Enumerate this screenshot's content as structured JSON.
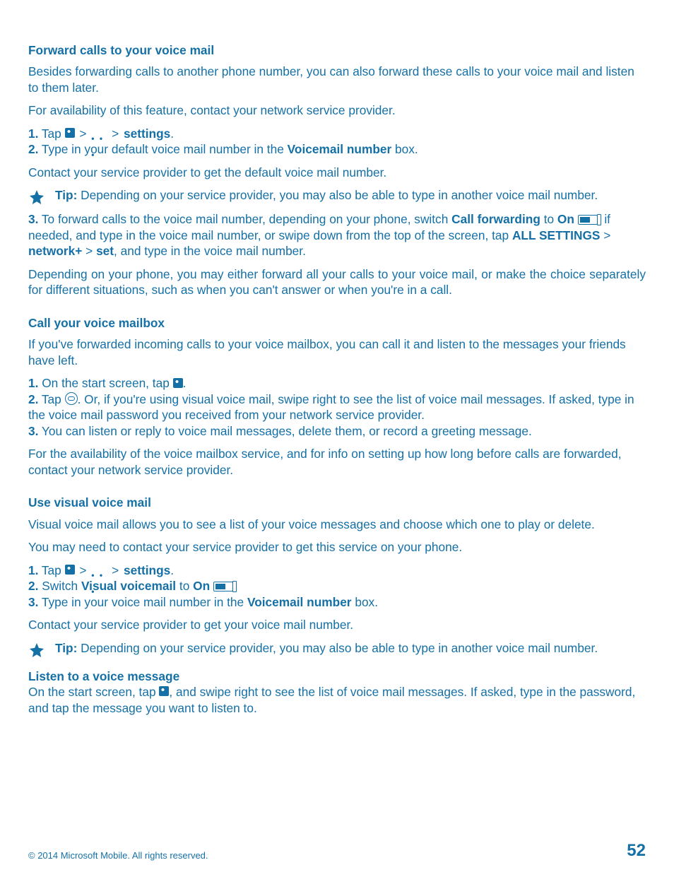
{
  "s1": {
    "heading": "Forward calls to your voice mail",
    "p1": "Besides forwarding calls to another phone number, you can also forward these calls to your voice mail and listen to them later.",
    "p2": "For availability of this feature, contact your network service provider.",
    "step1_a": "1.",
    "step1_b": " Tap ",
    "step1_c": " > ",
    "step1_d": " > ",
    "step1_e": "settings",
    "step1_f": ".",
    "step2_a": "2.",
    "step2_b": " Type in your default voice mail number in the ",
    "step2_c": "Voicemail number",
    "step2_d": " box.",
    "p3": "Contact your service provider to get the default voice mail number.",
    "tip_a": "Tip:",
    "tip_b": " Depending on your service provider, you may also be able to type in another voice mail number.",
    "step3_a": "3.",
    "step3_b": " To forward calls to the voice mail number, depending on your phone, switch ",
    "step3_c": "Call forwarding",
    "step3_d": " to ",
    "step3_e": "On",
    "step3_f": ", if needed, and type in the voice mail number, or swipe down from the top of the screen, tap ",
    "step3_g": "ALL SETTINGS",
    "step3_h": " > ",
    "step3_i": "network+",
    "step3_j": " > ",
    "step3_k": "set",
    "step3_l": ", and type in the voice mail number.",
    "p4": "Depending on your phone, you may either forward all your calls to your voice mail, or make the choice separately for different situations, such as when you can't answer or when you're in a call."
  },
  "s2": {
    "heading": "Call your voice mailbox",
    "p1": "If you've forwarded incoming calls to your voice mailbox, you can call it and listen to the messages your friends have left.",
    "step1_a": "1.",
    "step1_b": " On the start screen, tap ",
    "step1_c": ".",
    "step2_a": "2.",
    "step2_b": " Tap ",
    "step2_c": ". Or, if you're using visual voice mail, swipe right to see the list of voice mail messages. If asked, type in the voice mail password you received from your network service provider.",
    "step3_a": "3.",
    "step3_b": " You can listen or reply to voice mail messages, delete them, or record a greeting message.",
    "p2": "For the availability of the voice mailbox service, and for info on setting up how long before calls are forwarded, contact your network service provider."
  },
  "s3": {
    "heading": "Use visual voice mail",
    "p1": "Visual voice mail allows you to see a list of your voice messages and choose which one to play or delete.",
    "p2": "You may need to contact your service provider to get this service on your phone.",
    "step1_a": "1.",
    "step1_b": " Tap ",
    "step1_c": " > ",
    "step1_d": " > ",
    "step1_e": "settings",
    "step1_f": ".",
    "step2_a": "2.",
    "step2_b": " Switch ",
    "step2_c": "Visual voicemail",
    "step2_d": " to ",
    "step2_e": "On",
    "step2_f": ".",
    "step3_a": "3.",
    "step3_b": " Type in your voice mail number in the ",
    "step3_c": "Voicemail number",
    "step3_d": " box.",
    "p3": "Contact your service provider to get your voice mail number.",
    "tip_a": "Tip:",
    "tip_b": " Depending on your service provider, you may also be able to type in another voice mail number.",
    "sub": "Listen to a voice message",
    "sub_a": "On the start screen, tap ",
    "sub_b": ", and swipe right to see the list of voice mail messages. If asked, type in the password, and tap the message you want to listen to."
  },
  "footer": {
    "copyright": "© 2014 Microsoft Mobile. All rights reserved.",
    "page": "52"
  }
}
